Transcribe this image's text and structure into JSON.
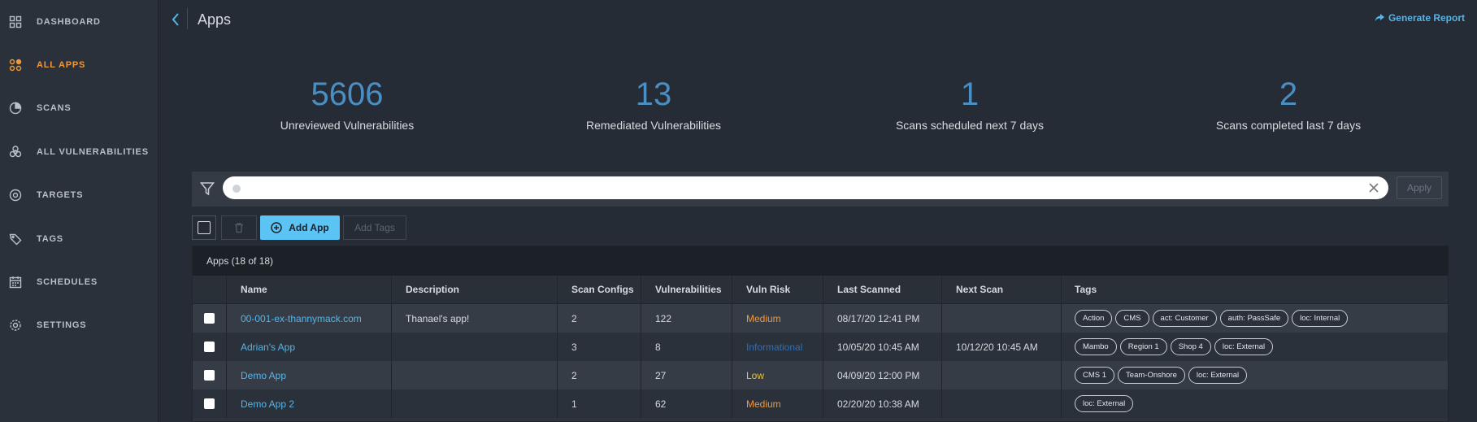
{
  "sidebar": {
    "items": [
      {
        "label": "DASHBOARD",
        "icon": "dashboard-icon",
        "active": false
      },
      {
        "label": "ALL APPS",
        "icon": "apps-icon",
        "active": true
      },
      {
        "label": "SCANS",
        "icon": "scans-icon",
        "active": false
      },
      {
        "label": "ALL VULNERABILITIES",
        "icon": "biohazard-icon",
        "active": false
      },
      {
        "label": "TARGETS",
        "icon": "target-icon",
        "active": false
      },
      {
        "label": "TAGS",
        "icon": "tag-icon",
        "active": false
      },
      {
        "label": "SCHEDULES",
        "icon": "calendar-icon",
        "active": false
      },
      {
        "label": "SETTINGS",
        "icon": "gear-icon",
        "active": false
      }
    ]
  },
  "header": {
    "title": "Apps",
    "generate_report": "Generate Report"
  },
  "stats": [
    {
      "value": "5606",
      "label": "Unreviewed Vulnerabilities"
    },
    {
      "value": "13",
      "label": "Remediated Vulnerabilities"
    },
    {
      "value": "1",
      "label": "Scans scheduled next 7 days"
    },
    {
      "value": "2",
      "label": "Scans completed last 7 days"
    }
  ],
  "filter": {
    "placeholder": "",
    "apply_label": "Apply"
  },
  "toolbar": {
    "add_app_label": "Add App",
    "add_tags_label": "Add Tags"
  },
  "table": {
    "caption": "Apps (18 of 18)",
    "columns": [
      "Name",
      "Description",
      "Scan Configs",
      "Vulnerabilities",
      "Vuln Risk",
      "Last Scanned",
      "Next Scan",
      "Tags"
    ],
    "rows": [
      {
        "name": "00-001-ex-thannymack.com",
        "description": "Thanael's app!",
        "scan_configs": "2",
        "vulnerabilities": "122",
        "vuln_risk": "Medium",
        "risk_color": "#ef9a3a",
        "last_scanned": "08/17/20 12:41 PM",
        "next_scan": "",
        "tags": [
          "Action",
          "CMS",
          "act: Customer",
          "auth: PassSafe",
          "loc: Internal"
        ]
      },
      {
        "name": "Adrian's App",
        "description": "",
        "scan_configs": "3",
        "vulnerabilities": "8",
        "vuln_risk": "Informational",
        "risk_color": "#2f6fb4",
        "last_scanned": "10/05/20 10:45 AM",
        "next_scan": "10/12/20 10:45 AM",
        "tags": [
          "Mambo",
          "Region 1",
          "Shop 4",
          "loc: External"
        ]
      },
      {
        "name": "Demo App",
        "description": "",
        "scan_configs": "2",
        "vulnerabilities": "27",
        "vuln_risk": "Low",
        "risk_color": "#e8c53a",
        "last_scanned": "04/09/20 12:00 PM",
        "next_scan": "",
        "tags": [
          "CMS 1",
          "Team-Onshore",
          "loc: External"
        ]
      },
      {
        "name": "Demo App 2",
        "description": "",
        "scan_configs": "1",
        "vulnerabilities": "62",
        "vuln_risk": "Medium",
        "risk_color": "#ef9a3a",
        "last_scanned": "02/20/20 10:38 AM",
        "next_scan": "",
        "tags": [
          "loc: External"
        ]
      }
    ]
  }
}
